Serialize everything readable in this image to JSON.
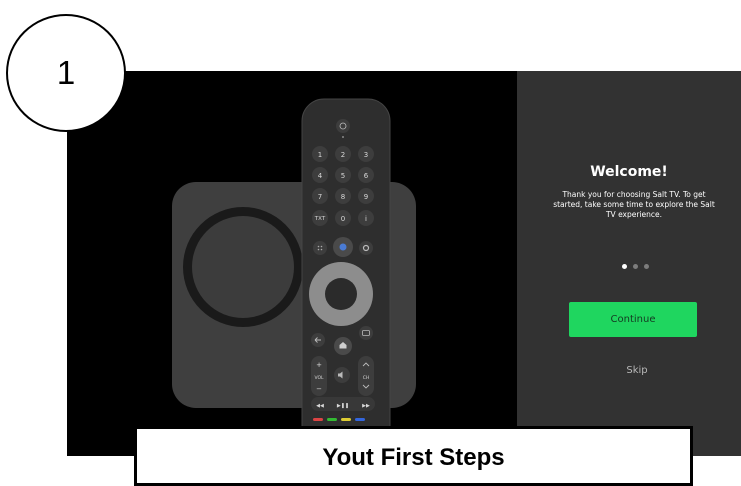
{
  "step": {
    "number": "1"
  },
  "caption": {
    "text": "Yout First Steps"
  },
  "welcome": {
    "title": "Welcome!",
    "body": "Thank you for choosing Salt TV. To get started, take some time to explore the Salt TV experience.",
    "continue_label": "Continue",
    "skip_label": "Skip",
    "pager": {
      "total": 3,
      "active": 1
    }
  },
  "remote": {
    "keys": {
      "k1": "1",
      "k2": "2",
      "k3": "3",
      "k4": "4",
      "k5": "5",
      "k6": "6",
      "k7": "7",
      "k8": "8",
      "k9": "9",
      "txt": "TXT",
      "k0": "0",
      "info": "i",
      "vol": "VOL",
      "ch": "CH"
    }
  },
  "colors": {
    "accent": "#1fd65f",
    "panel_background": "#323232",
    "screen_background": "#000000"
  }
}
